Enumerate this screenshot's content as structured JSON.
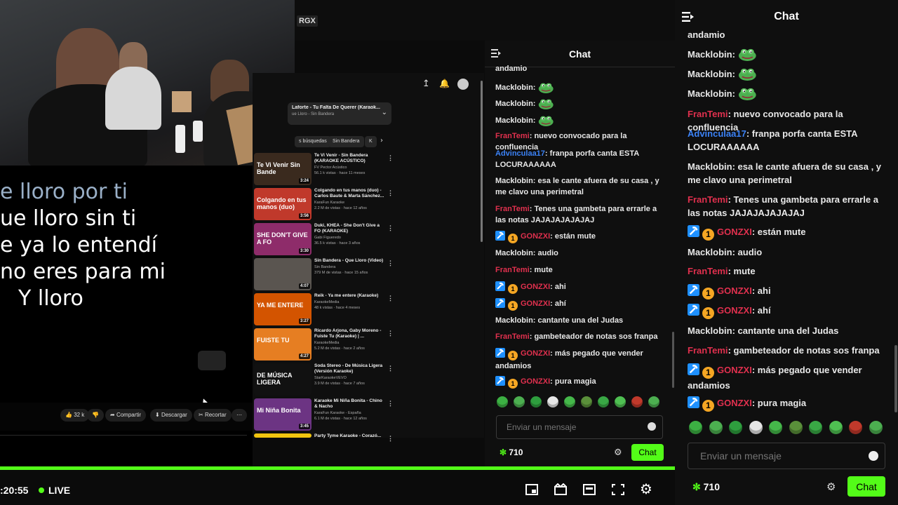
{
  "stream": {
    "tag": "RGX",
    "lyrics": [
      "e lloro por ti",
      "ue lloro sin ti",
      "e ya lo entendí",
      "no eres para mi",
      "Y lloro"
    ],
    "time": ":20:55",
    "live": "LIVE",
    "youtube": {
      "playlist_title": "Laforte - Tu Falta De Querer (Karaok...",
      "playlist_sub": "ue Lloro - Sin Bandera",
      "chips": [
        "s búsquedas",
        "Sin Bandera",
        "K"
      ],
      "actions": {
        "likes": "32 k",
        "share": "Compartir",
        "download": "Descargar",
        "clip": "Recortar"
      },
      "items": [
        {
          "thumb": "Te Vi Venir Sin Bande",
          "title": "Te Vi Venir - Sin Bandera (KARAOKE ACÚSTICO)",
          "channel": "FV Pector Acústico",
          "stats": "56.1 k vistas · hace 11 meses",
          "duration": "3:24",
          "color": "#3a2a1e"
        },
        {
          "thumb": "Colgando en tus manos (duo)",
          "title": "Colgando en tus manos (duo) - Carlos Baute & Marta Sánchez...",
          "channel": "KaraFun Karaoke",
          "stats": "2.2 M de vistas · hace 12 años",
          "duration": "3:56",
          "color": "#c0392b"
        },
        {
          "thumb": "SHE DON'T GIVE A FO",
          "title": "Duki, KHEA - She Don't Give a FO (KARAOKE)",
          "channel": "Gabi Figueredo",
          "stats": "36.5 k vistas · hace 3 años",
          "duration": "3:30",
          "color": "#8e2c6a"
        },
        {
          "thumb": "",
          "title": "Sin Bandera - Que Lloro (Video)",
          "channel": "Sin Bandera",
          "stats": "379 M de vistas · hace 15 años",
          "duration": "4:07",
          "color": "#5a5550"
        },
        {
          "thumb": "YA ME ENTERE",
          "title": "Reik - Ya me entere (Karaoke)",
          "channel": "KaraokeMedia",
          "stats": "48 k vistas · hace 4 meses",
          "duration": "3:27",
          "color": "#d35400"
        },
        {
          "thumb": "FUISTE TU",
          "title": "Ricardo Arjona, Gaby Moreno - Fuiste Tu (Karaoke) | ...",
          "channel": "KaraokeMedia",
          "stats": "5.2 M de vistas · hace 2 años",
          "duration": "4:27",
          "color": "#e67e22"
        },
        {
          "thumb": "DE MÚSICA LIGERA",
          "title": "Soda Stereo - De Música Ligera (Versión Karaoke)",
          "channel": "StarKaraokeVEVO",
          "stats": "3.9 M de vistas · hace 7 años",
          "duration": "",
          "color": "#111111"
        },
        {
          "thumb": "Mi Niña Bonita",
          "title": "Karaoke Mi Niña Bonita - Chino & Nacho",
          "channel": "KaraFun Karaoke - España",
          "stats": "6.1 M de vistas · hace 12 años",
          "duration": "3:45",
          "color": "#6c3483"
        },
        {
          "thumb": "",
          "title": "Party Tyme Karaoke - Corazó...",
          "channel": "",
          "stats": "",
          "duration": "",
          "color": "#f1c40f"
        }
      ]
    }
  },
  "chat": {
    "title": "Chat",
    "placeholder": "Enviar un mensaje",
    "points": "710",
    "send": "Chat",
    "colors": {
      "green_user": "#e8e8e8",
      "red_user": "#e0304e",
      "blue_user": "#3b82f6",
      "accent": "#53fc18"
    },
    "messages": [
      {
        "user": "",
        "text": "andamio",
        "color": "white",
        "badges": false,
        "emote": false
      },
      {
        "user": "Macklobin",
        "text": "",
        "color": "white",
        "badges": false,
        "emote": true
      },
      {
        "user": "Macklobin",
        "text": "",
        "color": "white",
        "badges": false,
        "emote": true
      },
      {
        "user": "Macklobin",
        "text": "",
        "color": "white",
        "badges": false,
        "emote": true
      },
      {
        "user": "FranTemi",
        "text": "nuevo convocado para la confluencia",
        "color": "red",
        "badges": false,
        "emote": false
      },
      {
        "user": "Advinculaa17",
        "text": "franpa porfa canta ESTA LOCURAAAAAA",
        "color": "blue",
        "badges": false,
        "emote": false
      },
      {
        "user": "Macklobin",
        "text": "esa le cante afuera de su casa , y me clavo una perimetral",
        "color": "white",
        "badges": false,
        "emote": false
      },
      {
        "user": "FranTemi",
        "text": "Tenes una gambeta para errarle a las notas JAJAJAJAJAJAJ",
        "color": "red",
        "badges": false,
        "emote": false
      },
      {
        "user": "GONZXI",
        "text": "están mute",
        "color": "red",
        "badges": true,
        "emote": false
      },
      {
        "user": "Macklobin",
        "text": "audio",
        "color": "white",
        "badges": false,
        "emote": false
      },
      {
        "user": "FranTemi",
        "text": "mute",
        "color": "red",
        "badges": false,
        "emote": false
      },
      {
        "user": "GONZXI",
        "text": "ahi",
        "color": "red",
        "badges": true,
        "emote": false
      },
      {
        "user": "GONZXI",
        "text": "ahí",
        "color": "red",
        "badges": true,
        "emote": false
      },
      {
        "user": "Macklobin",
        "text": "cantante una del Judas",
        "color": "white",
        "badges": false,
        "emote": false
      },
      {
        "user": "FranTemi",
        "text": "gambeteador de notas sos franpa",
        "color": "red",
        "badges": false,
        "emote": false
      },
      {
        "user": "GONZXI",
        "text": "más pegado que vender andamios",
        "color": "red",
        "badges": true,
        "emote": false
      },
      {
        "user": "GONZXI",
        "text": "pura magia",
        "color": "red",
        "badges": true,
        "emote": false
      }
    ],
    "emotes": [
      "frog-grin-emote",
      "frog-smile-emote",
      "frog-happy-emote",
      "frog-clown-emote",
      "frog-cube-emote",
      "frog-angry-emote",
      "frog-sparkle-emote",
      "frog-hug-emote",
      "frog-hat-emote",
      "frog-smirk-emote"
    ]
  }
}
